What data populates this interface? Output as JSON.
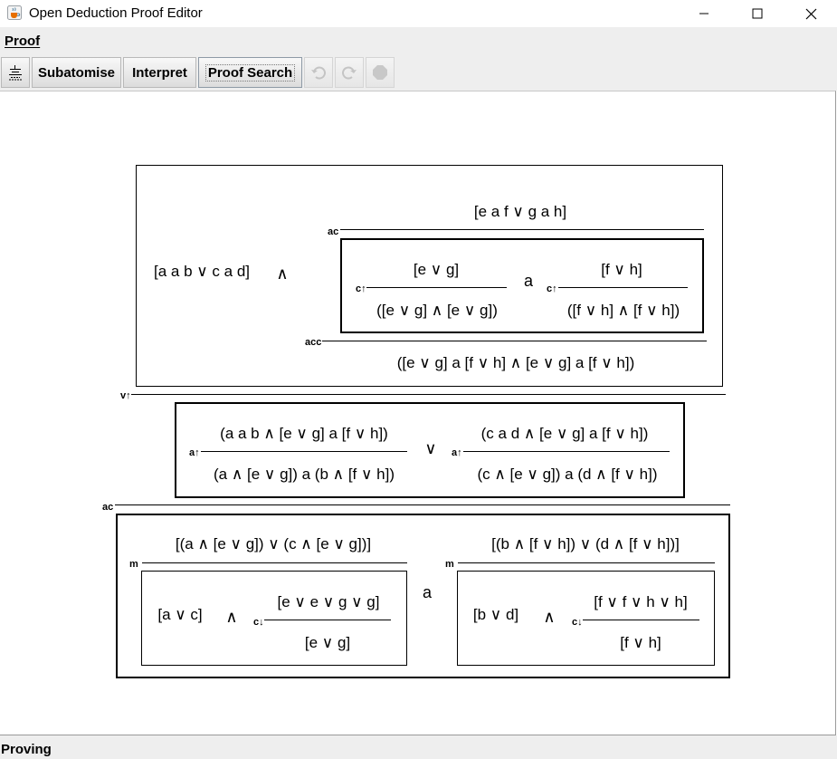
{
  "window": {
    "title": "Open Deduction Proof Editor",
    "icon": "java-cup-icon"
  },
  "menu": {
    "proof_label": "Proof"
  },
  "toolbar": {
    "layout_icon": "proof-layout-icon",
    "subatomise_label": "Subatomise",
    "interpret_label": "Interpret",
    "proof_search_label": "Proof Search",
    "undo_icon": "undo-icon",
    "redo_icon": "redo-icon",
    "stop_icon": "stop-icon"
  },
  "status": {
    "text": "Proving"
  },
  "proof": {
    "left_formula": "[a a b ∨ c a d]",
    "and_op": "∧",
    "or_op": "∨",
    "a_op": "a",
    "top_premise": "[e a f ∨ g a h]",
    "rule_ac": "ac",
    "rule_ct": "c↑",
    "rule_acc": "acc",
    "rule_vt": "v↑",
    "rule_at": "a↑",
    "rule_m": "m",
    "rule_cd": "c↓",
    "ct_left_premise": "[e ∨ g]",
    "ct_left_conclusion": "([e ∨ g] ∧ [e ∨ g])",
    "ct_right_premise": "[f ∨ h]",
    "ct_right_conclusion": "([f ∨ h] ∧ [f ∨ h])",
    "acc_conclusion": "([e ∨ g] a [f ∨ h] ∧ [e ∨ g] a [f ∨ h])",
    "at_left_premise": "(a a b ∧ [e ∨ g] a [f ∨ h])",
    "at_left_conclusion": "(a ∧ [e ∨ g]) a (b ∧ [f ∨ h])",
    "at_right_premise": "(c a d ∧ [e ∨ g] a [f ∨ h])",
    "at_right_conclusion": "(c ∧ [e ∨ g]) a (d ∧ [f ∨ h])",
    "m_left_conclusion": "[(a ∧ [e ∨ g]) ∨ (c ∧ [e ∨ g])]",
    "m_right_conclusion": "[(b ∧ [f ∨ h]) ∨ (d ∧ [f ∨ h])]",
    "m_left_inner_formula": "[a ∨ c]",
    "m_left_cd_premise": "[e ∨ e ∨ g ∨ g]",
    "m_left_cd_conclusion": "[e ∨ g]",
    "m_right_inner_formula": "[b ∨ d]",
    "m_right_cd_premise": "[f ∨ f ∨ h ∨ h]",
    "m_right_cd_conclusion": "[f ∨ h]"
  }
}
